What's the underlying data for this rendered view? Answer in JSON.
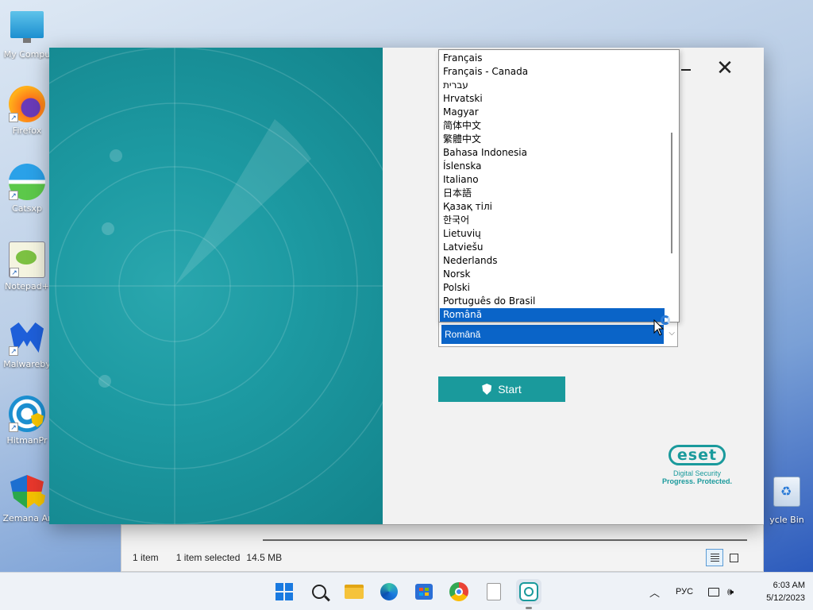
{
  "desktop": {
    "icons": [
      {
        "label": "My Compu",
        "icon": "computer-icon"
      },
      {
        "label": "Firefox",
        "icon": "firefox-icon"
      },
      {
        "label": "Catsxp",
        "icon": "catsxp-icon"
      },
      {
        "label": "Notepad+",
        "icon": "notepad-plus-icon"
      },
      {
        "label": "Malwareby",
        "icon": "malwarebytes-icon"
      },
      {
        "label": "HitmanPr",
        "icon": "hitmanpro-icon"
      },
      {
        "label": "Zemana Ar",
        "icon": "zemana-icon"
      }
    ],
    "recycle_bin": {
      "label": "ycle Bin",
      "icon": "recycle-bin-icon"
    }
  },
  "explorer": {
    "status_items": "1 item",
    "status_selected": "1 item selected",
    "status_size": "14.5 MB"
  },
  "installer": {
    "language_options": [
      "Français",
      "Français - Canada",
      "עברית",
      "Hrvatski",
      "Magyar",
      "简体中文",
      "繁體中文",
      "Bahasa Indonesia",
      "Íslenska",
      "Italiano",
      "日本語",
      "Қазақ тілі",
      "한국어",
      "Lietuvių",
      "Latviešu",
      "Nederlands",
      "Norsk",
      "Polski",
      "Português do Brasil",
      "Română"
    ],
    "selected_language": "Română",
    "start_label": "Start",
    "logo_text": "eset",
    "logo_line1": "Digital Security",
    "logo_line2": "Progress. Protected.",
    "accent_color": "#1a9a9c",
    "selection_color": "#0a64c8"
  },
  "taskbar": {
    "language": "РУС",
    "time": "6:03 AM",
    "date": "5/12/2023",
    "apps": [
      "start-icon",
      "search-icon",
      "file-explorer-icon",
      "edge-icon",
      "store-icon",
      "chrome-icon",
      "notepad-icon",
      "eset-icon"
    ]
  }
}
